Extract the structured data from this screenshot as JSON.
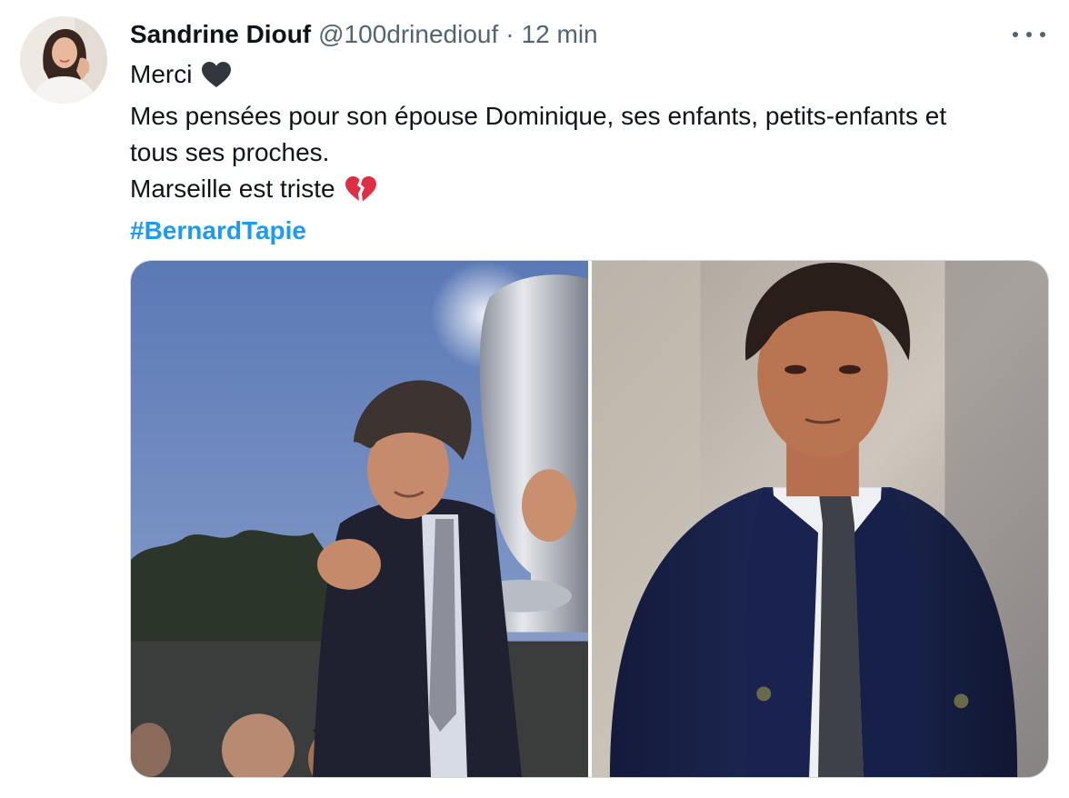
{
  "tweet": {
    "author": {
      "display_name": "Sandrine Diouf",
      "handle": "@100drinediouf",
      "separator": "·",
      "time": "12 min"
    },
    "more_icon": "more-horizontal-icon",
    "text": {
      "line1": "Merci",
      "line1_emoji": "black-heart-icon",
      "line2": "Mes pensées pour son épouse Dominique, ses enfants, petits-enfants et",
      "line3": "tous ses proches.",
      "line4": "Marseille est triste",
      "line4_emoji": "broken-heart-icon",
      "hashtag": "#BernardTapie"
    },
    "colors": {
      "hashtag": "#1d9bf0",
      "secondary_text": "#536471",
      "primary_text": "#0f1419"
    },
    "media": {
      "count": 2
    }
  }
}
